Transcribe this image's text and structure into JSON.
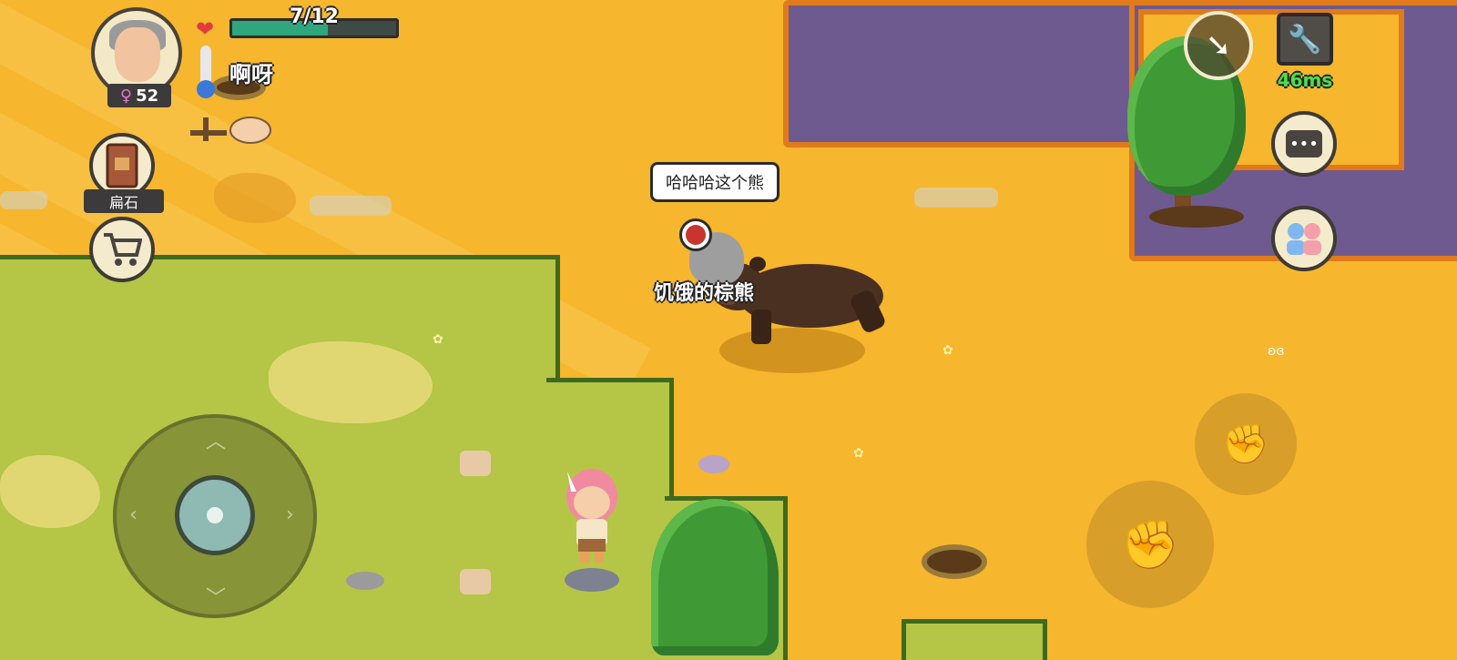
{
  "hud": {
    "health": {
      "current": 7,
      "max": 12,
      "text": "7/12"
    },
    "status_text": "啊呀",
    "gender_symbol": "♀",
    "level": "52",
    "thermometer_icon": "thermometer-icon"
  },
  "menu": {
    "book_label": "扁石",
    "shop_icon": "shopping-cart-icon"
  },
  "top_right": {
    "ping": "46ms",
    "compass_icon": "compass-arrow-icon",
    "settings_icon": "wrench-icon",
    "chat_icon": "chat-bubble-icon",
    "friends_icon": "friends-icon"
  },
  "world": {
    "npc_speech": "哈哈哈这个熊",
    "npc_label": "饥饿的棕熊"
  },
  "colors": {
    "sand": "#f6b62d",
    "grass": "#b5c546",
    "water": "#6e5a8e",
    "health_fill": "#2fa67d",
    "ping_green": "#4be04b"
  }
}
